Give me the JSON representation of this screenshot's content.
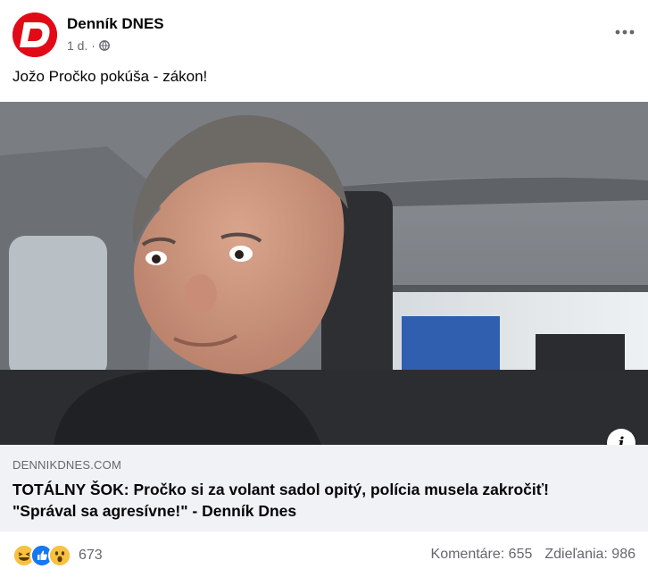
{
  "header": {
    "page_name": "Denník DNES",
    "time": "1 d. ·",
    "avatar_letter": "D",
    "brand_color": "#e20a17",
    "privacy_icon": "globe-icon",
    "more_icon": "more-options-icon"
  },
  "post": {
    "caption": "Jožo Pročko pokúša - zákon!"
  },
  "link": {
    "domain": "DENNIKDNES.COM",
    "headline_line1": "TOTÁLNY ŠOK: Pročko si za volant sadol opitý, polícia musela zakročiť!",
    "headline_line2": "\"Správal sa agresívne!\" - Denník Dnes",
    "info_icon": "info-icon",
    "info_label": "i"
  },
  "footer": {
    "reaction_icons": [
      "haha-icon",
      "like-icon",
      "wow-icon"
    ],
    "reaction_count": "673",
    "comments": "Komentáre: 655",
    "shares": "Zdieľania: 986"
  }
}
